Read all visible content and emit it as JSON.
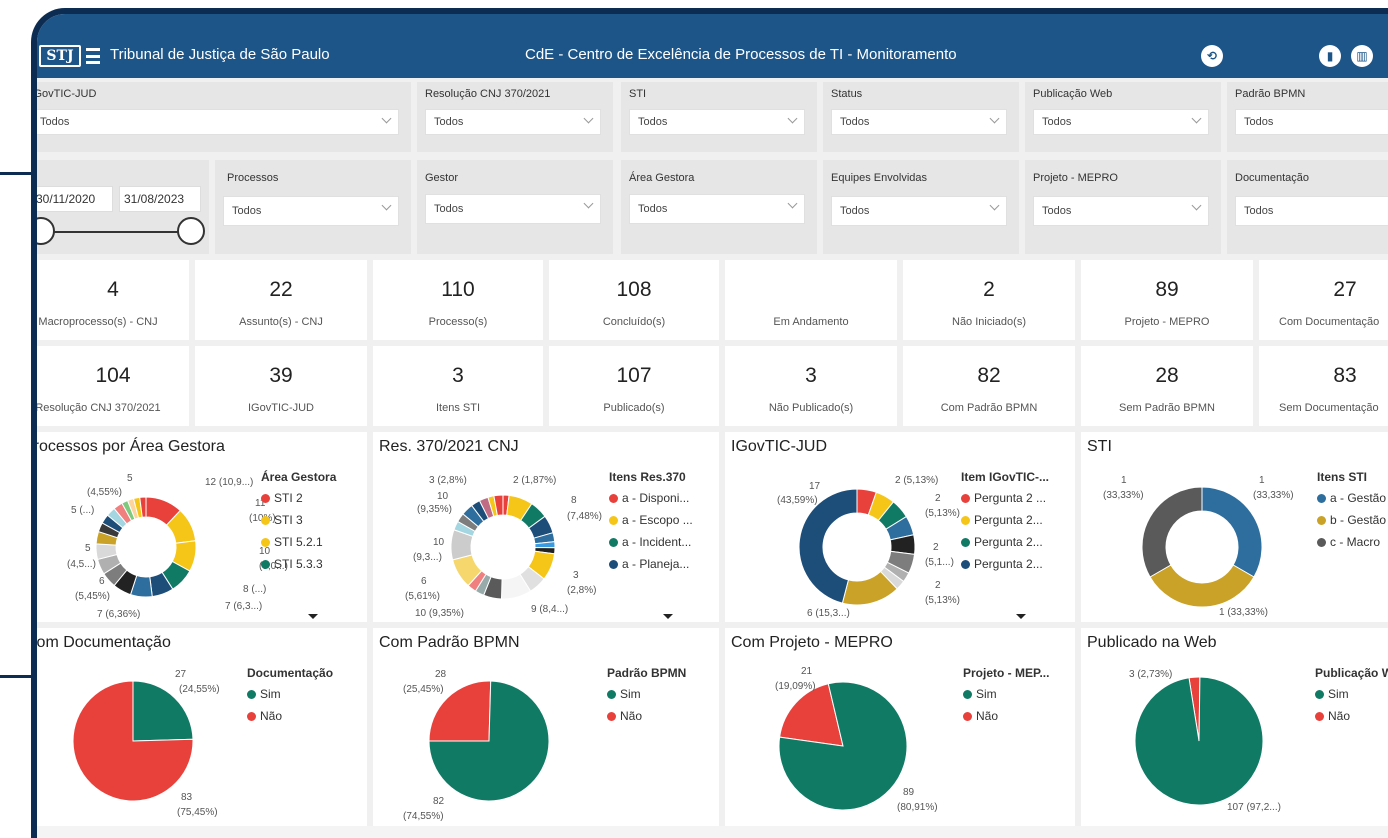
{
  "header": {
    "logo_text": "STJ",
    "tj_title": "Tribunal de Justiça de São Paulo",
    "main_title": "CdE - Centro de Excelência de Processos de TI - Monitoramento",
    "accent": "#1d5588"
  },
  "filters": {
    "row1": [
      {
        "label": "iGovTIC-JUD",
        "value": "Todos"
      },
      {
        "label": "Resolução CNJ 370/2021",
        "value": "Todos"
      },
      {
        "label": "STI",
        "value": "Todos"
      },
      {
        "label": "Status",
        "value": "Todos"
      },
      {
        "label": "Publicação Web",
        "value": "Todos"
      },
      {
        "label": "Padrão BPMN",
        "value": "Todos"
      }
    ],
    "row2": [
      {
        "label": "Processos",
        "value": "Todos"
      },
      {
        "label": "Gestor",
        "value": "Todos"
      },
      {
        "label": "Área Gestora",
        "value": "Todos"
      },
      {
        "label": "Equipes Envolvidas",
        "value": "Todos"
      },
      {
        "label": "Projeto - MEPRO",
        "value": "Todos"
      },
      {
        "label": "Documentação",
        "value": "Todos"
      }
    ],
    "date_start": "30/11/2020",
    "date_end": "31/08/2023"
  },
  "kpis_row1": [
    {
      "value": "4",
      "label": "Macroprocesso(s) - CNJ"
    },
    {
      "value": "22",
      "label": "Assunto(s) - CNJ"
    },
    {
      "value": "110",
      "label": "Processo(s)"
    },
    {
      "value": "108",
      "label": "Concluído(s)"
    },
    {
      "value": "",
      "label": "Em Andamento"
    },
    {
      "value": "2",
      "label": "Não Iniciado(s)"
    },
    {
      "value": "89",
      "label": "Projeto - MEPRO"
    },
    {
      "value": "27",
      "label": "Com Documentação"
    }
  ],
  "kpis_row2": [
    {
      "value": "104",
      "label": "Resolução CNJ 370/2021"
    },
    {
      "value": "39",
      "label": "IGovTIC-JUD"
    },
    {
      "value": "3",
      "label": "Itens STI"
    },
    {
      "value": "107",
      "label": "Publicado(s)"
    },
    {
      "value": "3",
      "label": "Não Publicado(s)"
    },
    {
      "value": "82",
      "label": "Com Padrão BPMN"
    },
    {
      "value": "28",
      "label": "Sem Padrão BPMN"
    },
    {
      "value": "83",
      "label": "Sem Documentação"
    }
  ],
  "panels": {
    "area": {
      "title": "Processos por Área Gestora",
      "legend_title": "Área Gestora",
      "legend": [
        {
          "name": "STI 2",
          "color": "#e8413c"
        },
        {
          "name": "STI 3",
          "color": "#f5c518"
        },
        {
          "name": "STI 5.2.1",
          "color": "#f5c518"
        },
        {
          "name": "STI 5.3.3",
          "color": "#117a65"
        }
      ],
      "labels": [
        "5",
        "(4,55%)",
        "12 (10,9...)",
        "11",
        "(10%)",
        "10",
        "(9,0...)",
        "8 (...)",
        "7 (6,3...)",
        "7 (6,36%)",
        "6",
        "(5,45%)",
        "5",
        "(4,5...)",
        "5 (...)"
      ]
    },
    "res370": {
      "title": "Res. 370/2021 CNJ",
      "legend_title": "Itens Res.370",
      "legend": [
        {
          "name": "a - Disponi...",
          "color": "#e8413c"
        },
        {
          "name": "a - Escopo ...",
          "color": "#f5c518"
        },
        {
          "name": "a - Incident...",
          "color": "#117a65"
        },
        {
          "name": "a - Planeja...",
          "color": "#1d4e7a"
        }
      ],
      "labels": [
        "3 (2,8%)",
        "2 (1,87%)",
        "10",
        "(9,35%)",
        "8",
        "(7,48%)",
        "10",
        "(9,3...)",
        "3",
        "(2,8%)",
        "6",
        "(5,61%)",
        "10 (9,35%)",
        "9 (8,4...)"
      ]
    },
    "igov": {
      "title": "IGovTIC-JUD",
      "legend_title": "Item IGovTIC-...",
      "legend": [
        {
          "name": "Pergunta 2 ...",
          "color": "#e8413c"
        },
        {
          "name": "Pergunta 2...",
          "color": "#f5c518"
        },
        {
          "name": "Pergunta 2...",
          "color": "#117a65"
        },
        {
          "name": "Pergunta 2...",
          "color": "#1d4e7a"
        }
      ],
      "labels": [
        "17",
        "(43,59%)",
        "2 (5,13%)",
        "2",
        "(5,13%)",
        "2",
        "(5,1...)",
        "2",
        "(5,13%)",
        "6 (15,3...)"
      ]
    },
    "sti": {
      "title": "STI",
      "legend_title": "Itens STI",
      "legend": [
        {
          "name": "a - Gestão",
          "color": "#2e6e9e"
        },
        {
          "name": "b - Gestão",
          "color": "#c9a227"
        },
        {
          "name": "c - Macro",
          "color": "#5a5a5a"
        }
      ],
      "labels": [
        "1",
        "(33,33%)",
        "1",
        "(33,33%)",
        "1 (33,33%)"
      ]
    },
    "doc": {
      "title": "Com Documentação",
      "legend_title": "Documentação",
      "legend": [
        {
          "name": "Sim",
          "color": "#117a65"
        },
        {
          "name": "Não",
          "color": "#e8413c"
        }
      ],
      "labels": [
        "27",
        "(24,55%)",
        "83",
        "(75,45%)"
      ]
    },
    "bpmn": {
      "title": "Com Padrão BPMN",
      "legend_title": "Padrão BPMN",
      "legend": [
        {
          "name": "Sim",
          "color": "#117a65"
        },
        {
          "name": "Não",
          "color": "#e8413c"
        }
      ],
      "labels": [
        "28",
        "(25,45%)",
        "82",
        "(74,55%)"
      ]
    },
    "mepro": {
      "title": "Com Projeto - MEPRO",
      "legend_title": "Projeto - MEP...",
      "legend": [
        {
          "name": "Sim",
          "color": "#117a65"
        },
        {
          "name": "Não",
          "color": "#e8413c"
        }
      ],
      "labels": [
        "21",
        "(19,09%)",
        "89",
        "(80,91%)"
      ]
    },
    "web": {
      "title": "Publicado na Web",
      "legend_title": "Publicação Web",
      "legend": [
        {
          "name": "Sim",
          "color": "#117a65"
        },
        {
          "name": "Não",
          "color": "#e8413c"
        }
      ],
      "labels": [
        "3 (2,73%)",
        "107 (97,2...)"
      ]
    }
  },
  "chart_data": [
    {
      "type": "pie",
      "title": "Processos por Área Gestora",
      "donut": true,
      "slices": [
        12,
        11,
        10,
        8,
        7,
        7,
        6,
        5,
        5,
        5,
        4,
        3,
        3,
        3,
        3,
        2,
        2,
        2,
        2
      ],
      "colors": [
        "#e8413c",
        "#f5c518",
        "#f5c518",
        "#117a65",
        "#1d4e7a",
        "#2e6e9e",
        "#222222",
        "#7d7d7d",
        "#b0b0b0",
        "#d9d9d9",
        "#c9a227",
        "#3a3a3a",
        "#1d4e7a",
        "#a3d6e0",
        "#f08080",
        "#7fc97f",
        "#fdd49e",
        "#f5c518",
        "#e8413c"
      ]
    },
    {
      "type": "pie",
      "title": "Res. 370/2021 CNJ",
      "donut": true,
      "slices": [
        2,
        8,
        6,
        6,
        3,
        2,
        2,
        9,
        6,
        10,
        6,
        3,
        3,
        10,
        10,
        3,
        3,
        4,
        3,
        3,
        2,
        3
      ],
      "colors": [
        "#e8413c",
        "#f5c518",
        "#117a65",
        "#1d4e7a",
        "#2e6e9e",
        "#3b9be0",
        "#222222",
        "#f5c518",
        "#e0e0e0",
        "#f5f5f5",
        "#5a5a5a",
        "#9aa",
        "#f08080",
        "#f5d76e",
        "#cccccc",
        "#a3d6e0",
        "#7d7d7d",
        "#2e6e9e",
        "#1d4e7a",
        "#c06c84",
        "#f5c518",
        "#e8413c"
      ]
    },
    {
      "type": "pie",
      "title": "IGovTIC-JUD",
      "donut": true,
      "slices": [
        2,
        2,
        2,
        2,
        2,
        2,
        1,
        1,
        6,
        17
      ],
      "colors": [
        "#e8413c",
        "#f5c518",
        "#117a65",
        "#2e6e9e",
        "#222222",
        "#7d7d7d",
        "#b0b0b0",
        "#d9d9d9",
        "#c9a227",
        "#1d4e7a"
      ]
    },
    {
      "type": "pie",
      "title": "STI",
      "donut": true,
      "slices": [
        1,
        1,
        1
      ],
      "colors": [
        "#2e6e9e",
        "#c9a227",
        "#5a5a5a"
      ]
    },
    {
      "type": "pie",
      "title": "Com Documentação",
      "slices": [
        27,
        83
      ],
      "categories": [
        "Sim",
        "Não"
      ],
      "colors": [
        "#117a65",
        "#e8413c"
      ]
    },
    {
      "type": "pie",
      "title": "Com Padrão BPMN",
      "slices": [
        28,
        82
      ],
      "categories": [
        "Não",
        "Sim"
      ],
      "colors": [
        "#e8413c",
        "#117a65"
      ]
    },
    {
      "type": "pie",
      "title": "Com Projeto - MEPRO",
      "slices": [
        21,
        89
      ],
      "categories": [
        "Não",
        "Sim"
      ],
      "colors": [
        "#e8413c",
        "#117a65"
      ]
    },
    {
      "type": "pie",
      "title": "Publicado na Web",
      "slices": [
        3,
        107
      ],
      "categories": [
        "Não",
        "Sim"
      ],
      "colors": [
        "#e8413c",
        "#117a65"
      ]
    }
  ]
}
